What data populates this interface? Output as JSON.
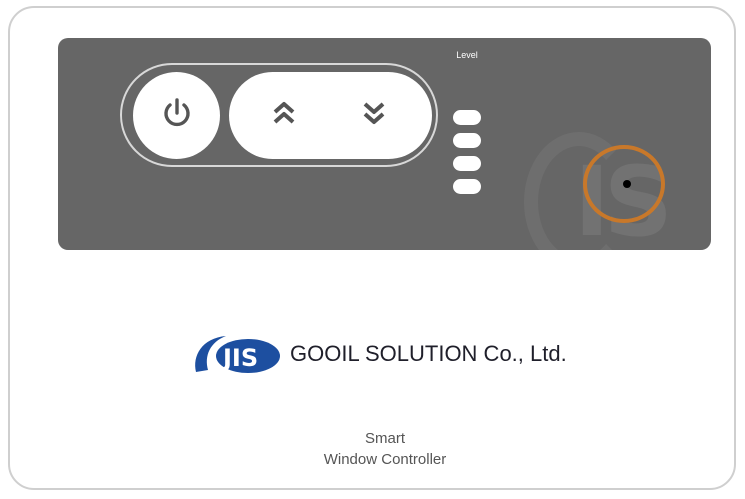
{
  "controller": {
    "level_label": "Level",
    "level_indicators": 4
  },
  "brand": {
    "logo_text": "JIS",
    "company_name": "GOOIL SOLUTION Co., Ltd.",
    "logo_color": "#1d4fa0"
  },
  "product": {
    "line1": "Smart",
    "line2": "Window Controller"
  },
  "icons": {
    "power": "power-icon",
    "up": "double-chevron-up-icon",
    "down": "double-chevron-down-icon",
    "sensor": "sensor-icon"
  },
  "colors": {
    "panel": "#666666",
    "sensor_ring": "#c8782a",
    "button": "#ffffff"
  }
}
